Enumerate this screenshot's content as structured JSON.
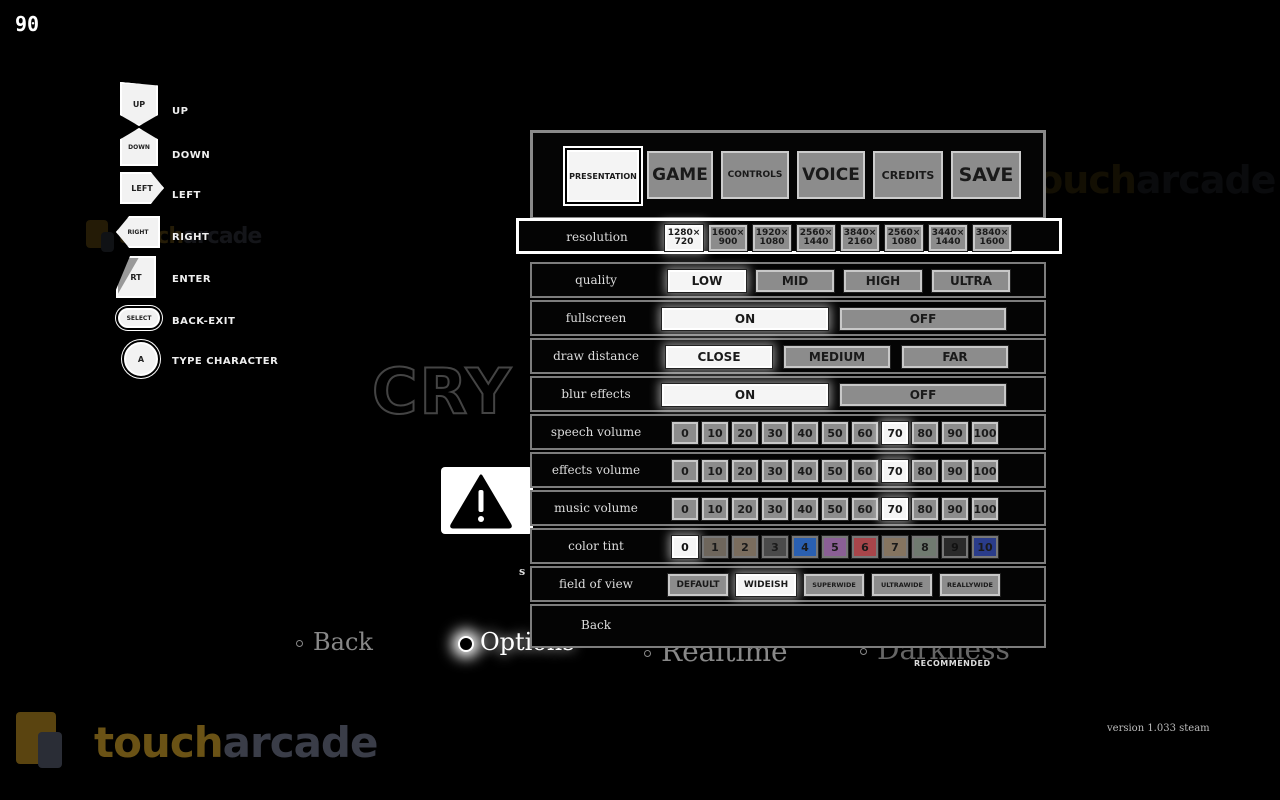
{
  "hud": {
    "fps": "90"
  },
  "watermark": {
    "brand_part1": "touch",
    "brand_part2": "arcade"
  },
  "background": {
    "game_logo_partial": "CRY",
    "stray_letter": "s"
  },
  "legend": [
    {
      "icon": "dpad-up-icon",
      "glyph": "UP",
      "action": "UP"
    },
    {
      "icon": "dpad-down-icon",
      "glyph": "DOWN",
      "action": "DOWN"
    },
    {
      "icon": "dpad-left-icon",
      "glyph": "LEFT",
      "action": "LEFT"
    },
    {
      "icon": "dpad-right-icon",
      "glyph": "RIGHT",
      "action": "RIGHT"
    },
    {
      "icon": "rt-trigger-icon",
      "glyph": "RT",
      "action": "ENTER"
    },
    {
      "icon": "select-button-icon",
      "glyph": "SELECT",
      "action": "BACK-EXIT"
    },
    {
      "icon": "a-button-icon",
      "glyph": "A",
      "action": "TYPE CHARACTER"
    }
  ],
  "tabs": [
    {
      "label": "PRESENTATION",
      "active": true
    },
    {
      "label": "GAME",
      "active": false
    },
    {
      "label": "CONTROLS",
      "active": false
    },
    {
      "label": "VOICE",
      "active": false
    },
    {
      "label": "CREDITS",
      "active": false
    },
    {
      "label": "SAVE",
      "active": false
    }
  ],
  "settings": {
    "resolution": {
      "label": "resolution",
      "options": [
        "1280×720",
        "1600×900",
        "1920×1080",
        "2560×1440",
        "3840×2160",
        "2560×1080",
        "3440×1440",
        "3840×1600"
      ],
      "opt_line1": [
        "1280×",
        "1600×",
        "1920×",
        "2560×",
        "3840×",
        "2560×",
        "3440×",
        "3840×"
      ],
      "opt_line2": [
        "720",
        "900",
        "1080",
        "1440",
        "2160",
        "1080",
        "1440",
        "1600"
      ],
      "selected": "1280×720"
    },
    "quality": {
      "label": "quality",
      "options": [
        "LOW",
        "MID",
        "HIGH",
        "ULTRA"
      ],
      "selected": "LOW"
    },
    "fullscreen": {
      "label": "fullscreen",
      "options": [
        "ON",
        "OFF"
      ],
      "selected": "ON"
    },
    "draw_distance": {
      "label": "draw distance",
      "options": [
        "CLOSE",
        "MEDIUM",
        "FAR"
      ],
      "selected": "CLOSE"
    },
    "blur_effects": {
      "label": "blur effects",
      "options": [
        "ON",
        "OFF"
      ],
      "selected": "ON"
    },
    "speech_volume": {
      "label": "speech volume",
      "options": [
        "0",
        "10",
        "20",
        "30",
        "40",
        "50",
        "60",
        "70",
        "80",
        "90",
        "100"
      ],
      "selected": "70"
    },
    "effects_volume": {
      "label": "effects volume",
      "options": [
        "0",
        "10",
        "20",
        "30",
        "40",
        "50",
        "60",
        "70",
        "80",
        "90",
        "100"
      ],
      "selected": "70"
    },
    "music_volume": {
      "label": "music volume",
      "options": [
        "0",
        "10",
        "20",
        "30",
        "40",
        "50",
        "60",
        "70",
        "80",
        "90",
        "100"
      ],
      "selected": "70"
    },
    "color_tint": {
      "label": "color tint",
      "options": [
        "0",
        "1",
        "2",
        "3",
        "4",
        "5",
        "6",
        "7",
        "8",
        "9",
        "10"
      ],
      "colors": [
        "#f5f5f5",
        "#6e665c",
        "#7a6d5e",
        "#4a4a4a",
        "#2a5fb0",
        "#8a5f95",
        "#a8454a",
        "#857460",
        "#707a70",
        "#2a2a2a",
        "#2a3c8a"
      ],
      "selected": "0"
    },
    "field_of_view": {
      "label": "field of view",
      "options": [
        "DEFAULT",
        "WIDEISH",
        "SUPERWIDE",
        "ULTRAWIDE",
        "REALLYWIDE"
      ],
      "selected": "WIDEISH"
    },
    "back": {
      "label": "Back"
    }
  },
  "bottom_menu": [
    {
      "label": "Back",
      "active": false
    },
    {
      "label": "Options",
      "active": true
    },
    {
      "label": "Realtime",
      "active": false
    },
    {
      "label": "Darkness",
      "active": false
    }
  ],
  "recommended_label": "RECOMMENDED",
  "version": "version 1.033 steam"
}
